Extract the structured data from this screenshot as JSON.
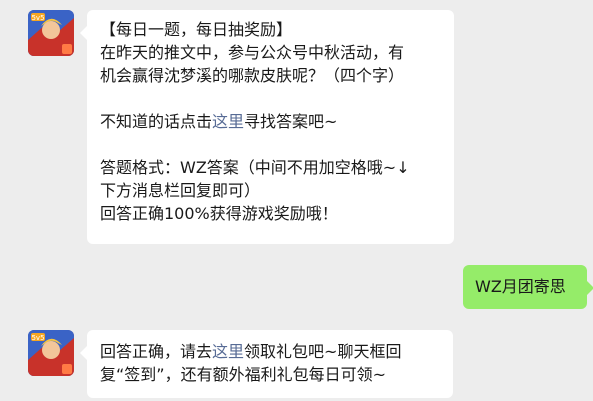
{
  "messages": [
    {
      "sender": "official",
      "lines": {
        "l1": "【每日一题，每日抽奖励】",
        "l2": "在昨天的推文中，参与公众号中秋活动，有",
        "l3": "机会赢得沈梦溪的哪款皮肤呢？（四个字）",
        "l4_pre": "不知道的话点击",
        "l4_link": "这里",
        "l4_post": "寻找答案吧~",
        "l5": "答题格式：WZ答案（中间不用加空格哦~↓",
        "l6": "下方消息栏回复即可）",
        "l7": "回答正确100%获得游戏奖励哦！"
      }
    },
    {
      "sender": "user",
      "text": "WZ月团寄思"
    },
    {
      "sender": "official",
      "lines": {
        "l1_pre": "回答正确，请去",
        "l1_link": "这里",
        "l1_post": "领取礼包吧~聊天框回",
        "l2": "复“签到”，还有额外福利礼包每日可领~"
      }
    }
  ],
  "colors": {
    "background": "#ededed",
    "incoming_bubble": "#ffffff",
    "outgoing_bubble": "#95ec69",
    "link": "#576b95"
  },
  "icons": {
    "avatar": "game-character-avatar-icon"
  }
}
